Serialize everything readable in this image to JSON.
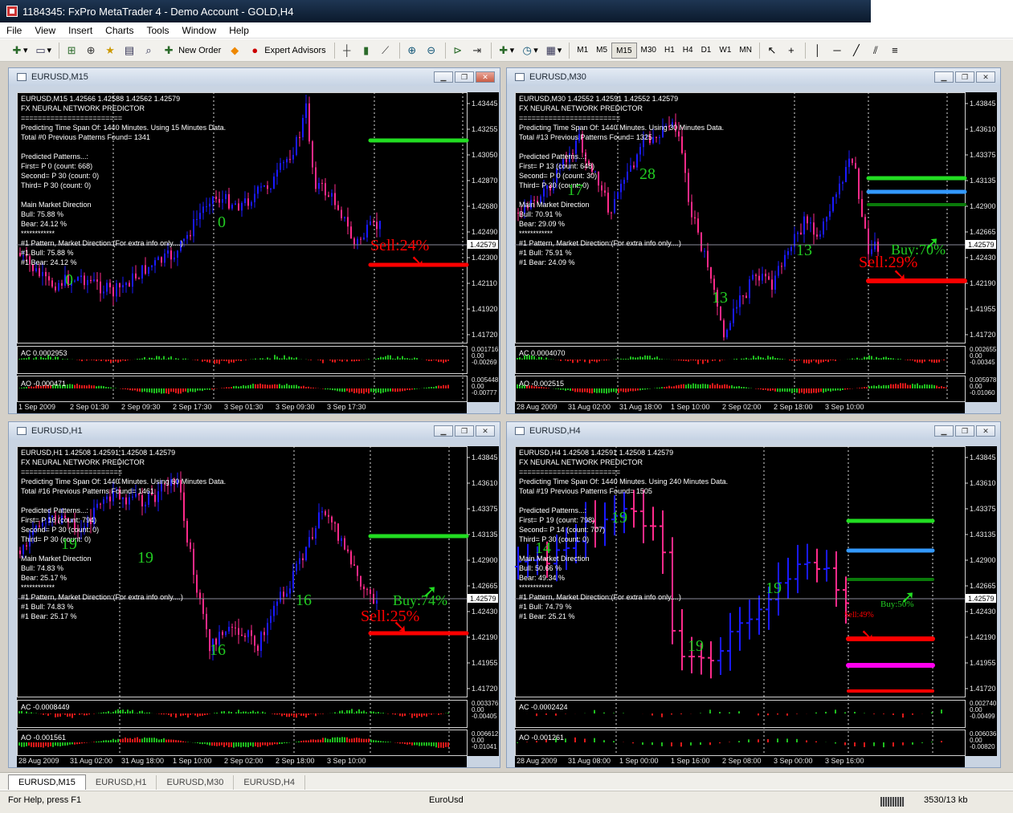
{
  "window": {
    "title": "1184345: FxPro MetaTrader 4 - Demo Account - GOLD,H4"
  },
  "menu": [
    "File",
    "View",
    "Insert",
    "Charts",
    "Tools",
    "Window",
    "Help"
  ],
  "toolbar": {
    "new_order": "New Order",
    "expert_advisors": "Expert Advisors",
    "timeframes": [
      "M1",
      "M5",
      "M15",
      "M30",
      "H1",
      "H4",
      "D1",
      "W1",
      "MN"
    ],
    "active_timeframe": "M15"
  },
  "colors": {
    "bull": "#1a1aff",
    "bear": "#ff2a8a",
    "buy": "#22dd22",
    "sell": "#ff0000",
    "label": "#22cc22",
    "blue_line": "#3399ff",
    "dark_green": "#0a7a0a",
    "magenta": "#ff00ee"
  },
  "charts": [
    {
      "title": "EURUSD,M15",
      "info": "EURUSD,M15  1.42566 1.42588 1.42562 1.42579",
      "lines": [
        "FX NEURAL NETWORK PREDICTOR",
        "========================",
        "Predicting Time Span Of: 1440 Minutes. Using 15 Minutes Data.",
        "Total #0 Previous Patterns Found= 1341",
        "",
        "Predicted Patterns...:",
        "First= P 0  (count: 668)",
        "Second= P 30  (count: 0)",
        "Third= P 30  (count: 0)",
        "",
        "Main Market Direction",
        "Bull: 75.88 %",
        "Bear: 24.12 %",
        "************",
        "#1 Pattern, Market Direction:(For extra info only....)",
        "#1 Bull: 75.88 %",
        "#1 Bear: 24.12 %"
      ],
      "prices": [
        "1.43445",
        "1.43255",
        "1.43050",
        "1.42870",
        "1.42680",
        "1.42490",
        "1.42300",
        "1.42110",
        "1.41920",
        "1.41720"
      ],
      "current": "1.42579",
      "ac": "AC 0.0002953",
      "ao": "AO -0.000471",
      "ac_scale": [
        "0.001716",
        "0.00",
        "-0.00269"
      ],
      "ao_scale": [
        "0.005448",
        "0.00",
        "-0.00777"
      ],
      "dates": [
        "1 Sep 2009",
        "2 Sep 01:30",
        "2 Sep 09:30",
        "2 Sep 17:30",
        "3 Sep 01:30",
        "3 Sep 09:30",
        "3 Sep 17:30"
      ],
      "marks": [
        "0",
        "0"
      ],
      "buy": "",
      "sell": "Sell:24%"
    },
    {
      "title": "EURUSD,M30",
      "info": "EURUSD,M30  1.42552 1.42591 1.42552 1.42579",
      "lines": [
        "FX NEURAL NETWORK PREDICTOR",
        "========================",
        "Predicting Time Span Of: 1440 Minutes. Using 30 Minutes Data.",
        "Total #13 Previous Patterns Found= 1325",
        "",
        "Predicted Patterns...:",
        "First= P 13  (count: 648)",
        "Second= P 0  (count: 30)",
        "Third= P 30  (count: 0)",
        "",
        "Main Market Direction",
        "Bull: 70.91 %",
        "Bear: 29.09 %",
        "************",
        "#1 Pattern, Market Direction:(For extra info only....)",
        "#1 Bull: 75.91 %",
        "#1 Bear: 24.09 %"
      ],
      "prices": [
        "1.43845",
        "1.43610",
        "1.43375",
        "1.43135",
        "1.42900",
        "1.42665",
        "1.42430",
        "1.42190",
        "1.41955",
        "1.41720"
      ],
      "current": "1.42579",
      "ac": "AC 0.0004070",
      "ao": "AO -0.002515",
      "ac_scale": [
        "0.002655",
        "0.00",
        "-0.00345"
      ],
      "ao_scale": [
        "0.005978",
        "0.00",
        "-0.01060"
      ],
      "dates": [
        "28 Aug 2009",
        "31 Aug 02:00",
        "31 Aug 18:00",
        "1 Sep 10:00",
        "2 Sep 02:00",
        "2 Sep 18:00",
        "3 Sep 10:00"
      ],
      "marks": [
        "28",
        "17",
        "13",
        "13"
      ],
      "buy": "Buy:70%",
      "sell": "Sell:29%"
    },
    {
      "title": "EURUSD,H1",
      "info": "EURUSD,H1  1.42508 1.42591 1.42508 1.42579",
      "lines": [
        "FX NEURAL NETWORK PREDICTOR",
        "========================",
        "Predicting Time Span Of: 1440 Minutes. Using 60 Minutes Data.",
        "Total #16 Previous Patterns Found= 1461",
        "",
        "Predicted Patterns...:",
        "First= P 16  (count: 794)",
        "Second= P 30  (count: 0)",
        "Third= P 30  (count: 0)",
        "",
        "Main Market Direction",
        "Bull: 74.83 %",
        "Bear: 25.17 %",
        "************",
        "#1 Pattern, Market Direction:(For extra info only....)",
        "#1 Bull: 74.83 %",
        "#1 Bear: 25.17 %"
      ],
      "prices": [
        "1.43845",
        "1.43610",
        "1.43375",
        "1.43135",
        "1.42900",
        "1.42665",
        "1.42430",
        "1.42190",
        "1.41955",
        "1.41720"
      ],
      "current": "1.42579",
      "ac": "AC -0.0008449",
      "ao": "AO -0.001561",
      "ac_scale": [
        "0.003376",
        "0.00",
        "-0.00405"
      ],
      "ao_scale": [
        "0.006612",
        "0.00",
        "-0.01041"
      ],
      "dates": [
        "28 Aug 2009",
        "31 Aug 02:00",
        "31 Aug 18:00",
        "1 Sep 10:00",
        "2 Sep 02:00",
        "2 Sep 18:00",
        "3 Sep 10:00"
      ],
      "marks": [
        "19",
        "19",
        "16",
        "16"
      ],
      "buy": "Buy:74%",
      "sell": "Sell:25%"
    },
    {
      "title": "EURUSD,H4",
      "info": "EURUSD,H4  1.42508 1.42591 1.42508 1.42579",
      "lines": [
        "FX NEURAL NETWORK PREDICTOR",
        "========================",
        "Predicting Time Span Of: 1440 Minutes. Using 240 Minutes Data.",
        "Total #19 Previous Patterns Found= 1505",
        "",
        "Predicted Patterns...:",
        "First= P 19  (count: 798)",
        "Second= P 14  (count: 707)",
        "Third= P 30  (count: 0)",
        "",
        "Main Market Direction",
        "Bull: 50.66 %",
        "Bear: 49.34 %",
        "************",
        "#1 Pattern, Market Direction:(For extra info only....)",
        "#1 Bull: 74.79 %",
        "#1 Bear: 25.21 %"
      ],
      "prices": [
        "1.43845",
        "1.43610",
        "1.43375",
        "1.43135",
        "1.42900",
        "1.42665",
        "1.42430",
        "1.42190",
        "1.41955",
        "1.41720"
      ],
      "current": "1.42579",
      "ac": "AC -0.0002424",
      "ao": "AO -0.001261",
      "ac_scale": [
        "0.002740",
        "0.00",
        "-0.00499"
      ],
      "ao_scale": [
        "0.006036",
        "0.00",
        "-0.00820"
      ],
      "dates": [
        "28 Aug 2009",
        "31 Aug 08:00",
        "1 Sep 00:00",
        "1 Sep 16:00",
        "2 Sep 08:00",
        "3 Sep 00:00",
        "3 Sep 16:00"
      ],
      "marks": [
        "19",
        "14",
        "19",
        "19"
      ],
      "buy": "Buy:50%",
      "sell": "Sell:49%"
    }
  ],
  "tabs": [
    "EURUSD,M15",
    "EURUSD,H1",
    "EURUSD,M30",
    "EURUSD,H4"
  ],
  "active_tab": "EURUSD,M15",
  "status": {
    "help": "For Help, press F1",
    "profile": "EuroUsd",
    "traffic": "3530/13 kb"
  }
}
